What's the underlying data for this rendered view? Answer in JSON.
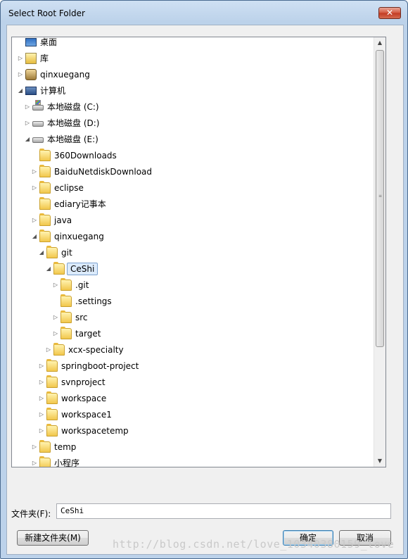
{
  "window": {
    "title": "Select Root Folder",
    "close_glyph": "✕"
  },
  "tree": {
    "items": [
      {
        "label": "桌面",
        "icon": "desktop-icon",
        "expander": ""
      },
      {
        "label": "库",
        "icon": "library-icon",
        "expander": "collapsed"
      },
      {
        "label": "qinxuegang",
        "icon": "user-folder-icon",
        "expander": "collapsed"
      },
      {
        "label": "计算机",
        "icon": "computer-icon",
        "expander": "expanded"
      },
      {
        "label": "本地磁盘 (C:)",
        "icon": "system-drive-icon",
        "expander": "collapsed"
      },
      {
        "label": "本地磁盘 (D:)",
        "icon": "drive-icon",
        "expander": "collapsed"
      },
      {
        "label": "本地磁盘 (E:)",
        "icon": "drive-icon",
        "expander": "expanded"
      },
      {
        "label": "360Downloads",
        "icon": "folder-icon",
        "expander": ""
      },
      {
        "label": "BaiduNetdiskDownload",
        "icon": "folder-icon",
        "expander": "collapsed"
      },
      {
        "label": "eclipse",
        "icon": "folder-icon",
        "expander": "collapsed"
      },
      {
        "label": "ediary记事本",
        "icon": "folder-icon",
        "expander": ""
      },
      {
        "label": "java",
        "icon": "folder-icon",
        "expander": "collapsed"
      },
      {
        "label": "qinxuegang",
        "icon": "folder-icon",
        "expander": "expanded"
      },
      {
        "label": "git",
        "icon": "folder-icon",
        "expander": "expanded"
      },
      {
        "label": "CeShi",
        "icon": "folder-icon",
        "expander": "expanded",
        "selected": true
      },
      {
        "label": ".git",
        "icon": "folder-icon",
        "expander": "collapsed"
      },
      {
        "label": ".settings",
        "icon": "folder-icon",
        "expander": ""
      },
      {
        "label": "src",
        "icon": "folder-icon",
        "expander": "collapsed"
      },
      {
        "label": "target",
        "icon": "folder-icon",
        "expander": "collapsed"
      },
      {
        "label": "xcx-specialty",
        "icon": "folder-icon",
        "expander": "collapsed"
      },
      {
        "label": "springboot-project",
        "icon": "folder-icon",
        "expander": "collapsed"
      },
      {
        "label": "svnproject",
        "icon": "folder-icon",
        "expander": "collapsed"
      },
      {
        "label": "workspace",
        "icon": "folder-icon",
        "expander": "collapsed"
      },
      {
        "label": "workspace1",
        "icon": "folder-icon",
        "expander": "collapsed"
      },
      {
        "label": "workspacetemp",
        "icon": "folder-icon",
        "expander": "collapsed"
      },
      {
        "label": "temp",
        "icon": "folder-icon",
        "expander": "collapsed"
      },
      {
        "label": "小程序",
        "icon": "folder-icon",
        "expander": "collapsed"
      }
    ]
  },
  "folder_field": {
    "label": "文件夹(F):",
    "value": "CeShi"
  },
  "buttons": {
    "new_folder": "新建文件夹(M)",
    "ok": "确定",
    "cancel": "取消"
  },
  "watermark": "http://blog.csdn.net/love_10340380159_love"
}
